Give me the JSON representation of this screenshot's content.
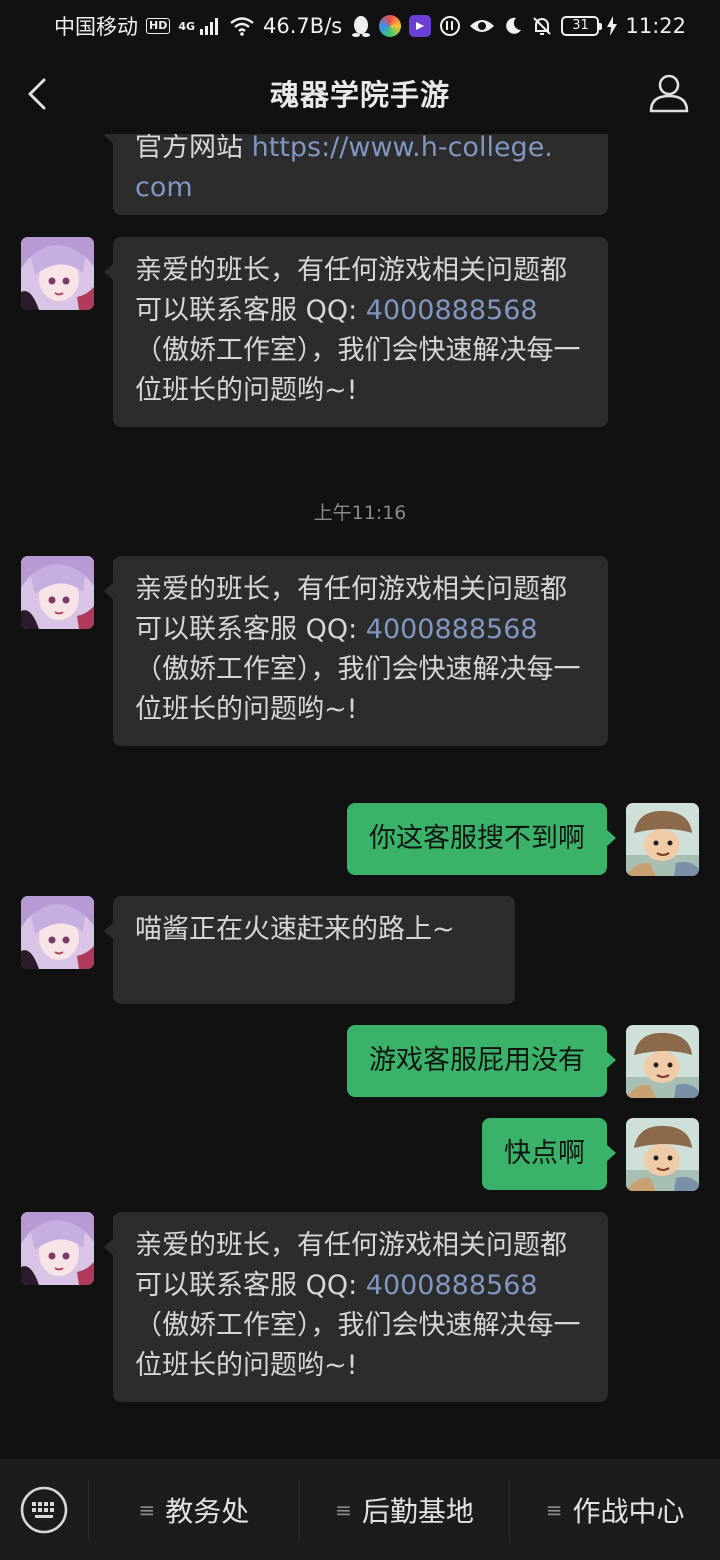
{
  "status_bar": {
    "carrier": "中国移动",
    "hd": "HD",
    "network": "4G",
    "speed": "46.7B/s",
    "battery": "31",
    "time": "11:22"
  },
  "header": {
    "title": "魂器学院手游",
    "back_icon": "chevron-left-icon",
    "profile_icon": "person-icon"
  },
  "messages": [
    {
      "from": "bot",
      "partial_text": "官方网站 ",
      "link": "https://www.h-college.com",
      "link_lines": [
        "https://www.h-college.",
        "com"
      ]
    },
    {
      "from": "bot",
      "text_a": "亲爱的班长，有任何游戏相关问题都可以联系客服 QQ: ",
      "qq": "4000888568",
      "text_b": "（傲娇工作室），我们会快速解决每一位班长的问题哟~!"
    },
    {
      "type": "time",
      "text": "上午11:16"
    },
    {
      "from": "bot",
      "text_a": "亲爱的班长，有任何游戏相关问题都可以联系客服 QQ: ",
      "qq": "4000888568",
      "text_b": "（傲娇工作室），我们会快速解决每一位班长的问题哟~!"
    },
    {
      "from": "user",
      "text": "你这客服搜不到啊"
    },
    {
      "from": "bot",
      "text": "喵酱正在火速赶来的路上~"
    },
    {
      "from": "user",
      "text": "游戏客服屁用没有"
    },
    {
      "from": "user",
      "text": "快点啊"
    },
    {
      "from": "bot",
      "text_a": "亲爱的班长，有任何游戏相关问题都可以联系客服 QQ: ",
      "qq": "4000888568",
      "text_b": "（傲娇工作室），我们会快速解决每一位班长的问题哟~!"
    }
  ],
  "bottom_menu": {
    "keyboard_icon": "keyboard-icon",
    "items": [
      {
        "label": "教务处",
        "icon": "menu-lines-icon"
      },
      {
        "label": "后勤基地",
        "icon": "menu-lines-icon"
      },
      {
        "label": "作战中心",
        "icon": "menu-lines-icon"
      }
    ]
  },
  "colors": {
    "background": "#111111",
    "bot_bubble": "#2c2c2c",
    "user_bubble": "#3ab26a",
    "link": "#7f97c2"
  }
}
